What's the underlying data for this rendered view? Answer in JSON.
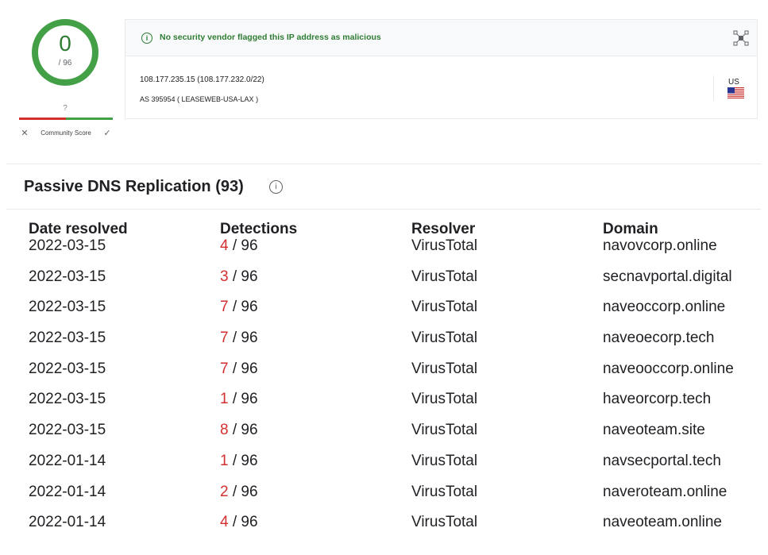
{
  "score": {
    "value": "0",
    "total": "/ 96",
    "community_unknown": "?",
    "community_label": "Community Score",
    "color": "#2e7d32"
  },
  "report": {
    "banner_text": "No security vendor flagged this IP address as malicious",
    "ip": "108.177.235.15  (108.177.232.0/22)",
    "as": "AS 395954 ( LEASEWEB-USA-LAX )",
    "country": "US"
  },
  "section": {
    "title": "Passive DNS Replication (93)"
  },
  "table": {
    "headers": [
      "Date resolved",
      "Detections",
      "Resolver",
      "Domain"
    ],
    "rows": [
      {
        "date": "2022-03-15",
        "positives": "4",
        "total": " / 96",
        "resolver": "VirusTotal",
        "domain": "navovcorp.online"
      },
      {
        "date": "2022-03-15",
        "positives": "3",
        "total": " / 96",
        "resolver": "VirusTotal",
        "domain": "secnavportal.digital"
      },
      {
        "date": "2022-03-15",
        "positives": "7",
        "total": " / 96",
        "resolver": "VirusTotal",
        "domain": "naveoccorp.online"
      },
      {
        "date": "2022-03-15",
        "positives": "7",
        "total": " / 96",
        "resolver": "VirusTotal",
        "domain": "naveoecorp.tech"
      },
      {
        "date": "2022-03-15",
        "positives": "7",
        "total": " / 96",
        "resolver": "VirusTotal",
        "domain": "naveooccorp.online"
      },
      {
        "date": "2022-03-15",
        "positives": "1",
        "total": " / 96",
        "resolver": "VirusTotal",
        "domain": "haveorcorp.tech"
      },
      {
        "date": "2022-03-15",
        "positives": "8",
        "total": " / 96",
        "resolver": "VirusTotal",
        "domain": "naveoteam.site"
      },
      {
        "date": "2022-01-14",
        "positives": "1",
        "total": " / 96",
        "resolver": "VirusTotal",
        "domain": "navsecportal.tech"
      },
      {
        "date": "2022-01-14",
        "positives": "2",
        "total": " / 96",
        "resolver": "VirusTotal",
        "domain": "naveroteam.online"
      },
      {
        "date": "2022-01-14",
        "positives": "4",
        "total": " / 96",
        "resolver": "VirusTotal",
        "domain": "naveoteam.online"
      }
    ]
  }
}
